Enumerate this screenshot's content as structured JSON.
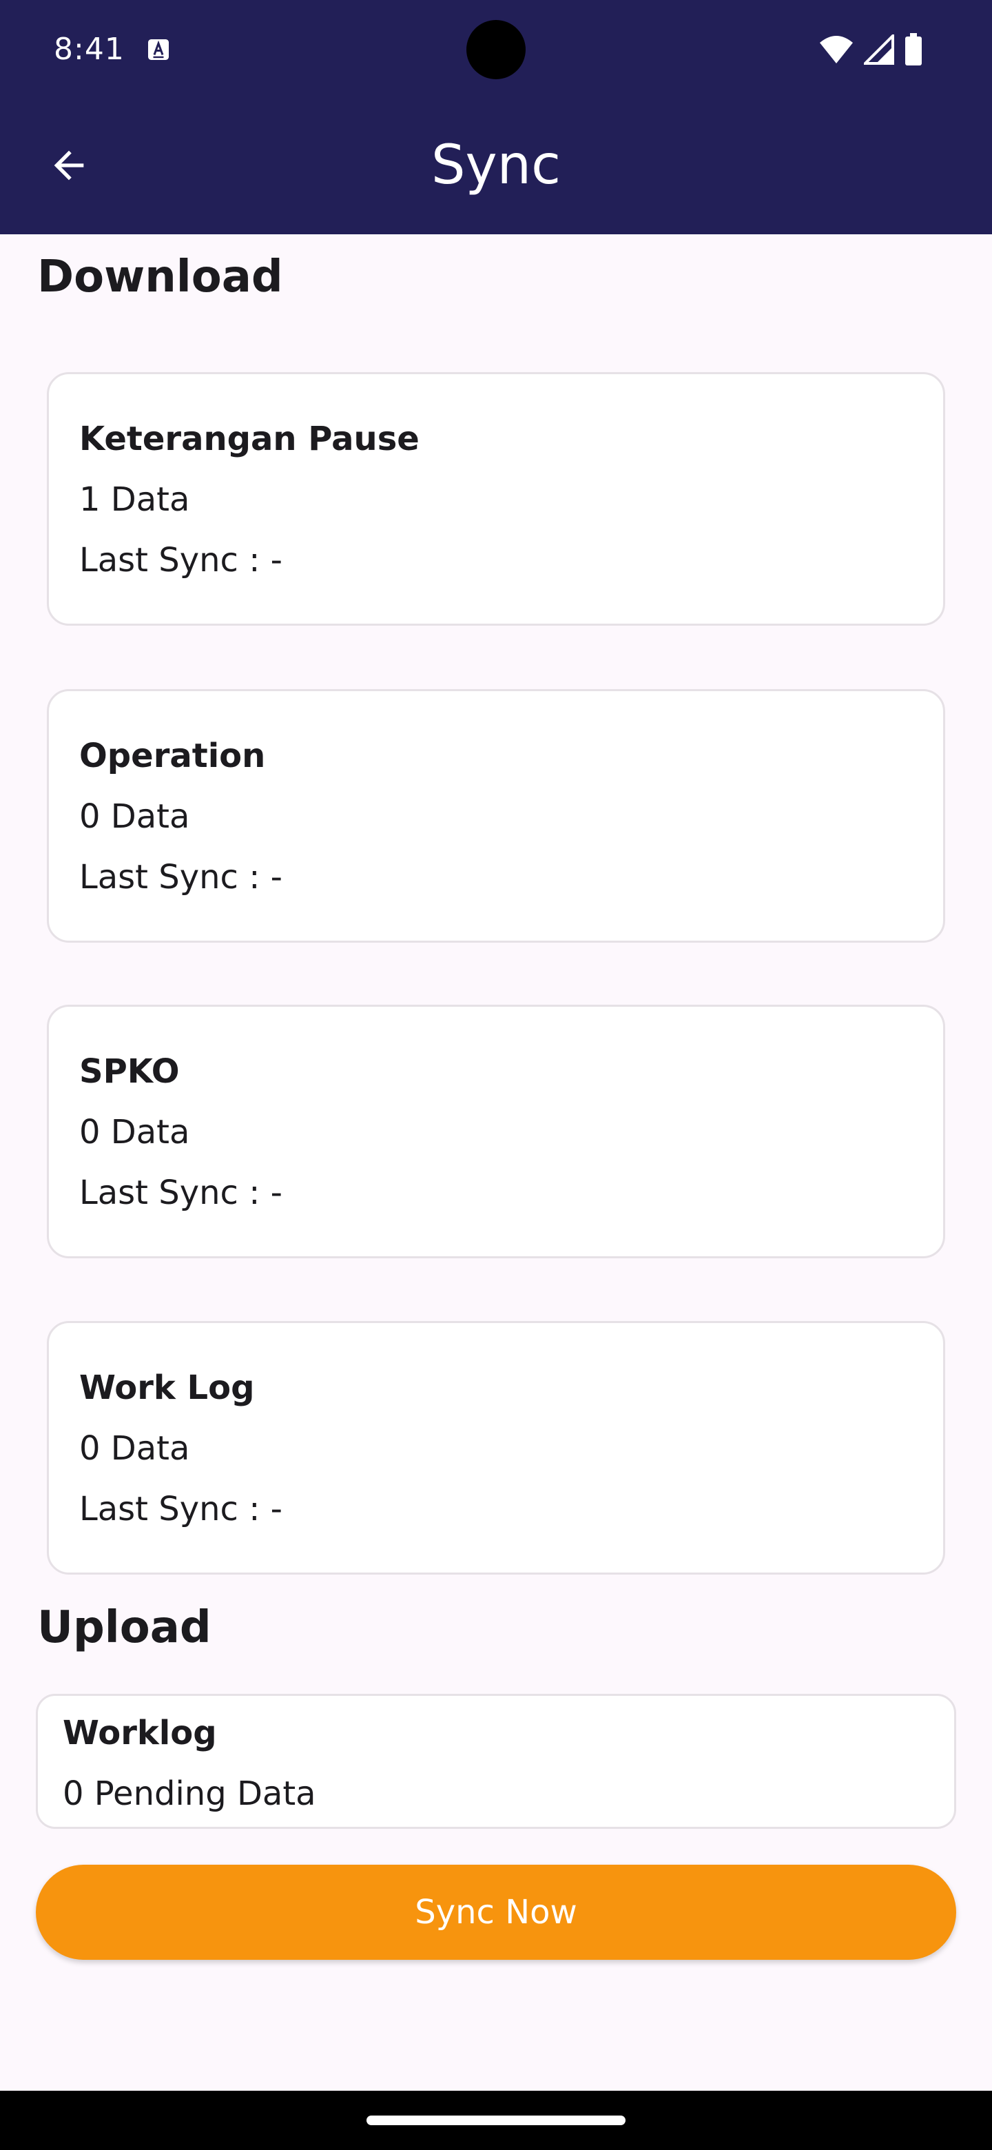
{
  "status_bar": {
    "time": "8:41",
    "icons": [
      "notification-a-icon",
      "wifi-icon",
      "signal-icon",
      "battery-icon"
    ]
  },
  "app_bar": {
    "title": "Sync",
    "back_icon": "arrow-back-icon"
  },
  "download": {
    "heading": "Download",
    "items": [
      {
        "title": "Keterangan Pause",
        "count": "1 Data",
        "last_sync": "Last Sync : -"
      },
      {
        "title": "Operation",
        "count": "0 Data",
        "last_sync": "Last Sync : -"
      },
      {
        "title": "SPKO",
        "count": "0 Data",
        "last_sync": "Last Sync : -"
      },
      {
        "title": "Work Log",
        "count": "0 Data",
        "last_sync": "Last Sync : -"
      }
    ]
  },
  "upload": {
    "heading": "Upload",
    "items": [
      {
        "title": "Worklog",
        "count": "0 Pending Data"
      }
    ]
  },
  "actions": {
    "sync_now": "Sync Now"
  },
  "colors": {
    "primary": "#221f57",
    "accent": "#f7940e",
    "background": "#fdf8fd",
    "card": "#ffffff",
    "text": "#1c1b1f"
  }
}
